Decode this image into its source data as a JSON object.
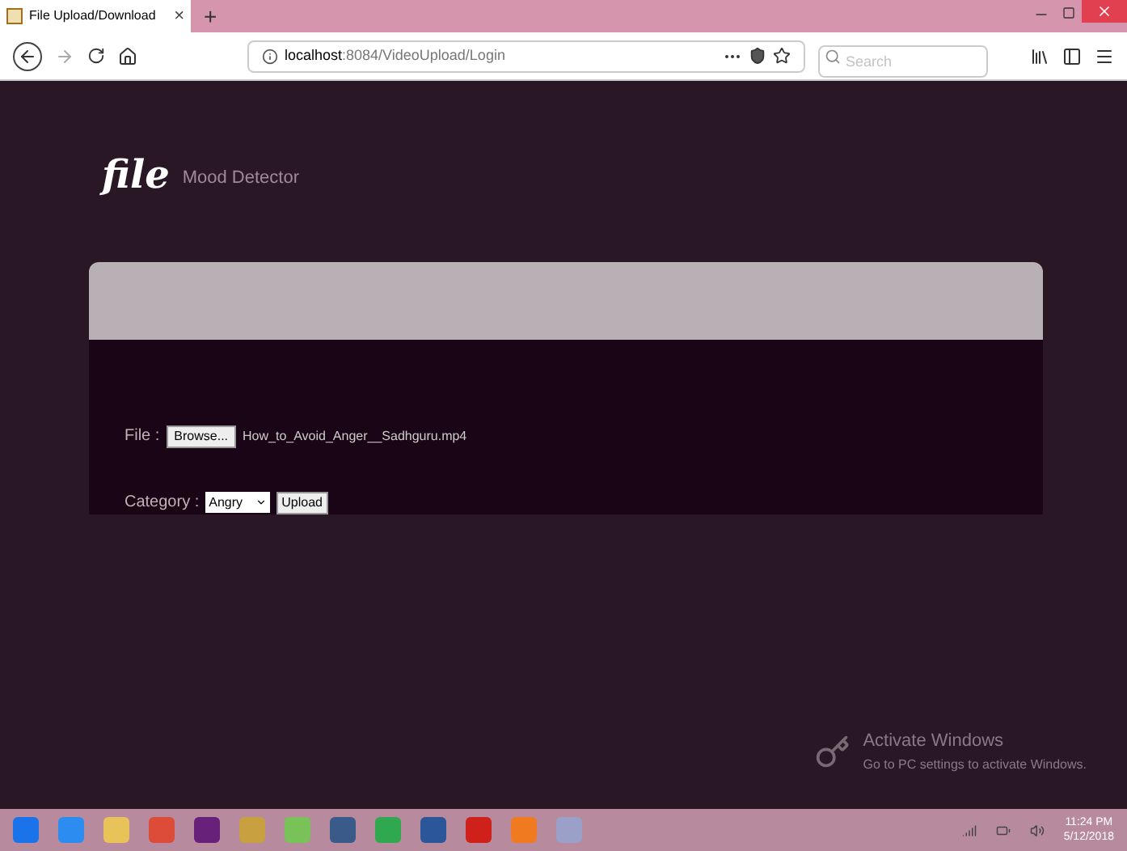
{
  "browser": {
    "tab": {
      "title": "File Upload/Download",
      "close": "×"
    },
    "new_tab": "+",
    "url_host": "localhost",
    "url_path": ":8084/VideoUpload/Login",
    "search": {
      "placeholder": "Search"
    }
  },
  "page": {
    "logo": "file",
    "app_name": "Mood Detector",
    "form": {
      "file_label": "File :",
      "browse_button": "Browse...",
      "file_name": "How_to_Avoid_Anger__Sadhguru.mp4",
      "category_label": "Category :",
      "category_value": "Angry",
      "upload_button": "Upload"
    }
  },
  "activation": {
    "title": "Activate Windows",
    "subtitle": "Go to PC settings to activate Windows."
  },
  "taskbar": {
    "apps": [
      {
        "color": "#1a73e8"
      },
      {
        "color": "#2d8cf0"
      },
      {
        "color": "#e8c35a"
      },
      {
        "color": "#dd4b39"
      },
      {
        "color": "#68217a"
      },
      {
        "color": "#c8a040"
      },
      {
        "color": "#78c257"
      },
      {
        "color": "#3a5a8a"
      },
      {
        "color": "#2fa84f"
      },
      {
        "color": "#2b579a"
      },
      {
        "color": "#d0201a"
      },
      {
        "color": "#f07a20"
      },
      {
        "color": "#9aa0c8"
      }
    ],
    "time": "11:24 PM",
    "date": "5/12/2018"
  }
}
